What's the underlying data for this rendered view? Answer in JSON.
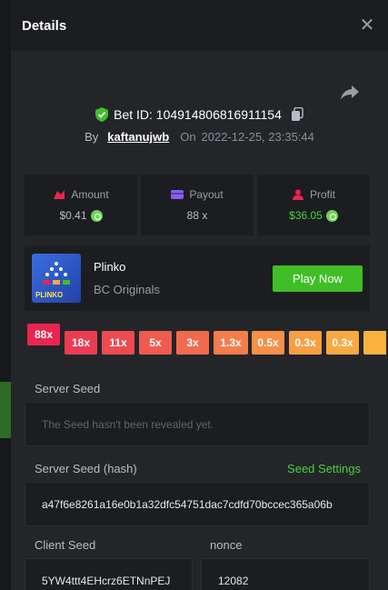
{
  "modal": {
    "title": "Details"
  },
  "bet": {
    "id_label": "Bet ID: 104914806816911154",
    "by_label": "By",
    "username": "kaftanujwb",
    "on_label": "On",
    "datetime": "2022-12-25, 23:35:44"
  },
  "stats": {
    "amount_label": "Amount",
    "amount_value": "$0.41",
    "payout_label": "Payout",
    "payout_value": "88 x",
    "profit_label": "Profit",
    "profit_value": "$36.05"
  },
  "game": {
    "name": "Plinko",
    "provider": "BC Originals",
    "play_label": "Play Now",
    "thumb_text": "PLINKO"
  },
  "multipliers": [
    {
      "label": "88x",
      "color": "#e8264f"
    },
    {
      "label": "18x",
      "color": "#ea3c52"
    },
    {
      "label": "11x",
      "color": "#ec4b52"
    },
    {
      "label": "5x",
      "color": "#ef5a51"
    },
    {
      "label": "3x",
      "color": "#f26a4e"
    },
    {
      "label": "1.3x",
      "color": "#f47d4b"
    },
    {
      "label": "0.5x",
      "color": "#f68f47"
    },
    {
      "label": "0.3x",
      "color": "#f89f43"
    },
    {
      "label": "0.3x",
      "color": "#f9a941"
    },
    {
      "label": "",
      "color": "#fbb13e"
    }
  ],
  "seeds": {
    "server_seed_label": "Server Seed",
    "server_seed_placeholder": "The Seed hasn't been revealed yet.",
    "server_hash_label": "Server Seed (hash)",
    "seed_settings_label": "Seed Settings",
    "server_hash_value": "a47f6e8261a16e0b1a32dfc54751dac7cdfd70bccec365a06b",
    "client_seed_label": "Client Seed",
    "client_seed_value": "5YW4ttt4EHcrz6ETNnPEJ",
    "nonce_label": "nonce",
    "nonce_value": "12082"
  },
  "colors": {
    "accent_green": "#3fbf25",
    "profit_green": "#48d13a",
    "shield_green": "#3fbf25"
  },
  "icons": [
    "close-icon",
    "share-icon",
    "shield-check-icon",
    "copy-icon",
    "amount-icon",
    "payout-icon",
    "profit-icon",
    "coin-icon"
  ]
}
